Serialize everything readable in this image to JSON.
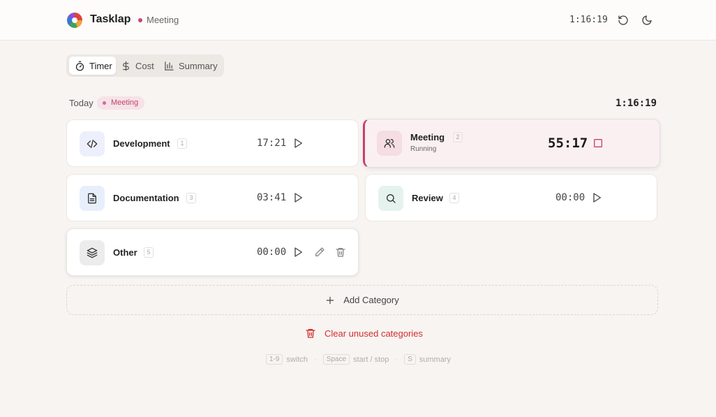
{
  "header": {
    "app_name": "Tasklap",
    "current_category": "Meeting",
    "elapsed": "1:16:19",
    "icons": [
      "reset-icon",
      "moon-icon"
    ]
  },
  "tabs": [
    {
      "label": "Timer",
      "icon": "stopwatch-icon",
      "active": true
    },
    {
      "label": "Cost",
      "icon": "dollar-icon",
      "active": false
    },
    {
      "label": "Summary",
      "icon": "bar-chart-icon",
      "active": false
    }
  ],
  "day": {
    "label": "Today",
    "badge": "Meeting",
    "total": "1:16:19"
  },
  "categories": [
    {
      "name": "Development",
      "key": "1",
      "time": "17:21",
      "icon": "code-icon",
      "running": false
    },
    {
      "name": "Meeting",
      "key": "2",
      "time": "55:17",
      "status": "Running",
      "icon": "users-icon",
      "running": true
    },
    {
      "name": "Documentation",
      "key": "3",
      "time": "03:41",
      "icon": "document-icon",
      "running": false
    },
    {
      "name": "Review",
      "key": "4",
      "time": "00:00",
      "icon": "search-icon",
      "running": false
    },
    {
      "name": "Other",
      "key": "5",
      "time": "00:00",
      "icon": "layers-icon",
      "running": false
    }
  ],
  "actions": {
    "add_category": "Add Category",
    "clear_unused": "Clear unused categories"
  },
  "shortcuts": [
    {
      "key": "1-9",
      "desc": "switch"
    },
    {
      "key": "Space",
      "desc": "start / stop"
    },
    {
      "key": "S",
      "desc": "summary"
    }
  ],
  "colors": {
    "accent": "#c7406f",
    "danger": "#d32f2f",
    "background": "#f7f4f1"
  }
}
